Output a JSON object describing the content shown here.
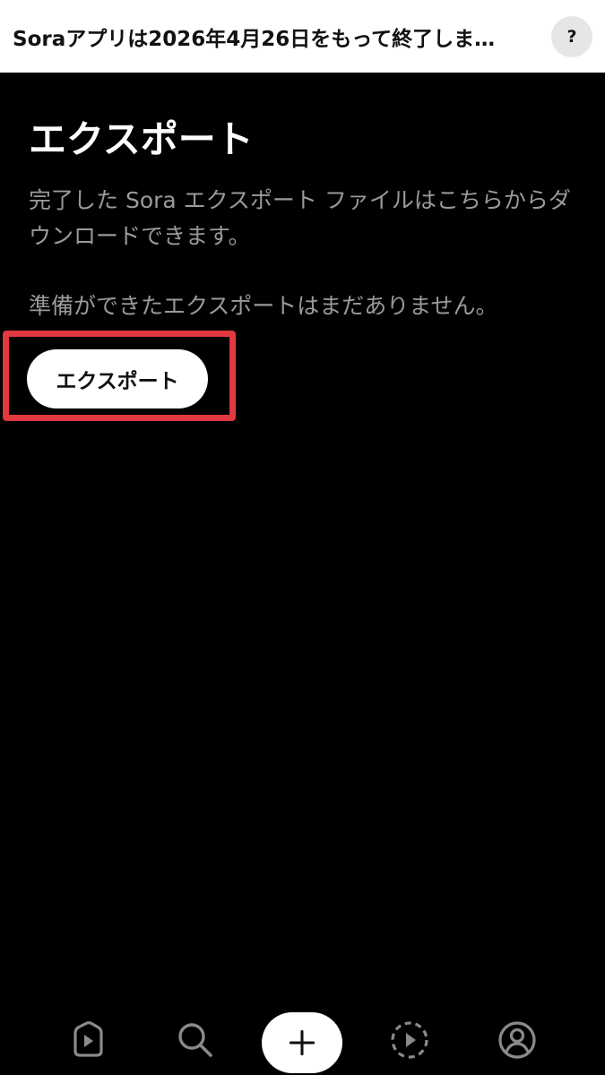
{
  "banner": {
    "text": "Soraアプリは2026年4月26日をもって終了しま…",
    "help_label": "?"
  },
  "main": {
    "title": "エクスポート",
    "description": "完了した Sora エクスポート ファイルはこちらからダウンロードできます。",
    "empty_message": "準備ができたエクスポートはまだありません。",
    "export_button_label": "エクスポート"
  },
  "nav": {
    "items": [
      {
        "icon": "play-feed-icon"
      },
      {
        "icon": "search-icon"
      },
      {
        "icon": "plus-icon"
      },
      {
        "icon": "drafts-play-icon"
      },
      {
        "icon": "profile-icon"
      }
    ]
  },
  "colors": {
    "background": "#000000",
    "banner_bg": "#ffffff",
    "secondary_text": "#9a9a9a",
    "highlight_border": "#e0393f"
  }
}
